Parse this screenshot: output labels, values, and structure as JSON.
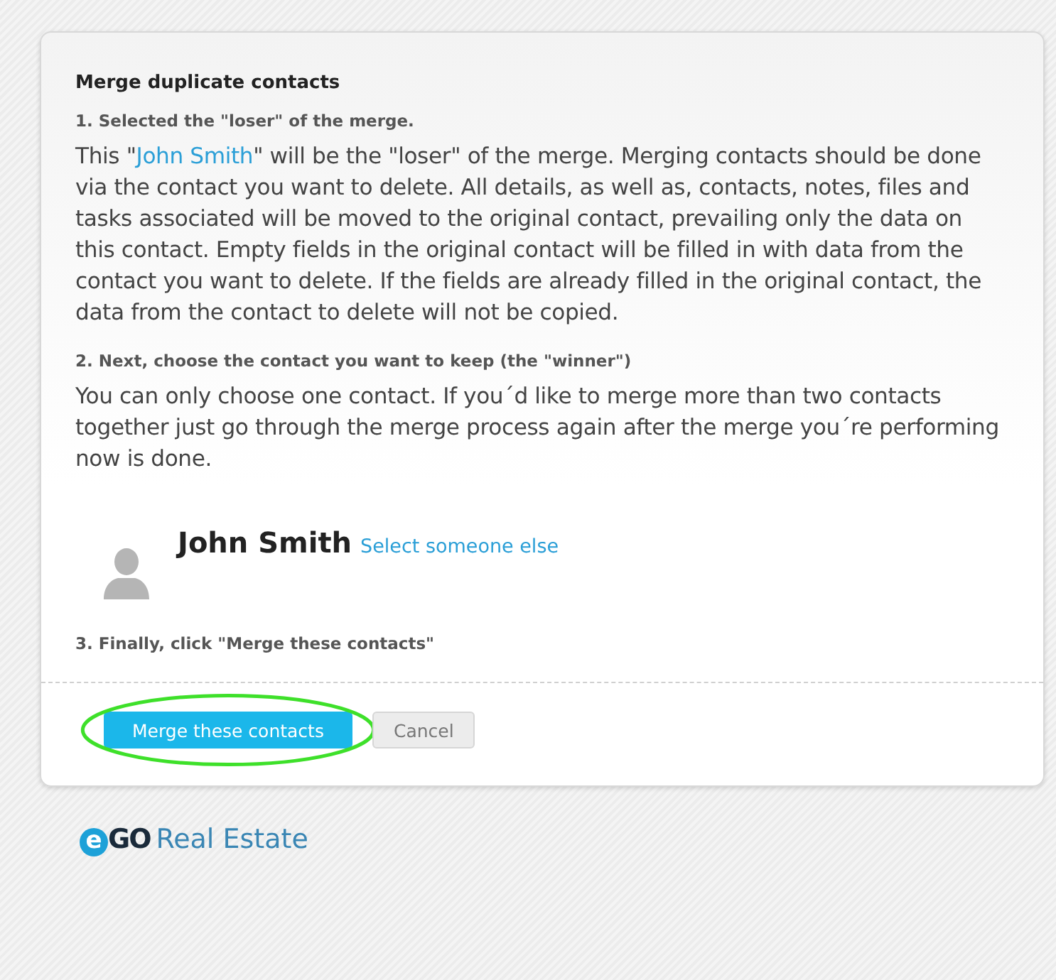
{
  "dialog": {
    "title": "Merge duplicate contacts",
    "step_1": {
      "heading": "1. Selected the \"loser\" of the merge.",
      "text_before": "This \"",
      "link": "John Smith",
      "text_after": "\" will be the \"loser\" of the merge. Merging contacts should be done via the contact you want to delete. All details, as well as, contacts, notes, files and tasks associated will be moved to the original contact, prevailing only the data on this contact. Empty fields in the original contact will be filled in with data from the contact you want to delete. If the fields are already filled in the original contact, the data from the contact to delete will not be copied."
    },
    "step_2": {
      "heading": "2. Next, choose the contact you want to keep (the \"winner\")",
      "text": "You can only choose one contact. If you´d like to merge more than two contacts together just go through the merge process again after the merge you´re performing now is done."
    },
    "contact": {
      "name": "John Smith",
      "change_link": "Select someone else"
    },
    "step_3": {
      "heading": "3. Finally, click \"Merge these contacts\""
    },
    "buttons": [
      {
        "label": "Merge these contacts",
        "kind": "primary",
        "highlighted": true
      },
      {
        "label": "Cancel",
        "kind": "secondary",
        "highlighted": false
      }
    ]
  },
  "footer": {
    "logo_mark": "e",
    "logo_brand": "GO",
    "logo_name": "Real Estate"
  }
}
